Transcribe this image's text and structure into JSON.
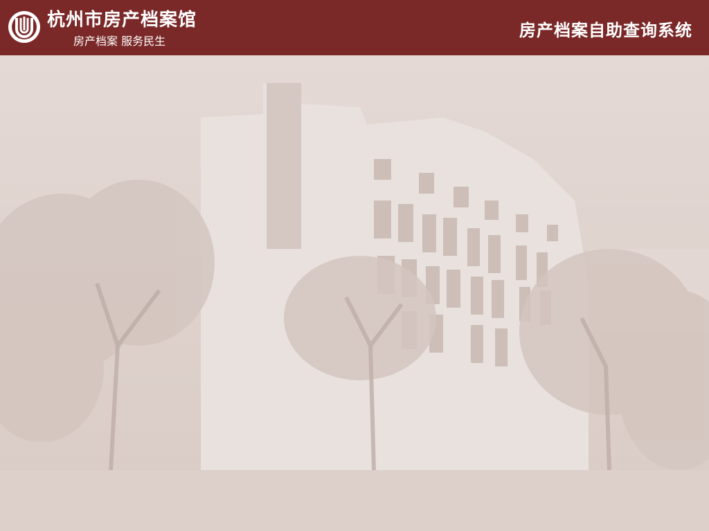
{
  "header": {
    "logo_icon": "archive-logo-icon",
    "brand_title": "杭州市房产档案馆",
    "brand_subtitle": "房产档案 服务民生",
    "system_title": "房产档案自助查询系统",
    "background_color": "#7a2828"
  },
  "background": {
    "image": "archive-building-photo"
  }
}
